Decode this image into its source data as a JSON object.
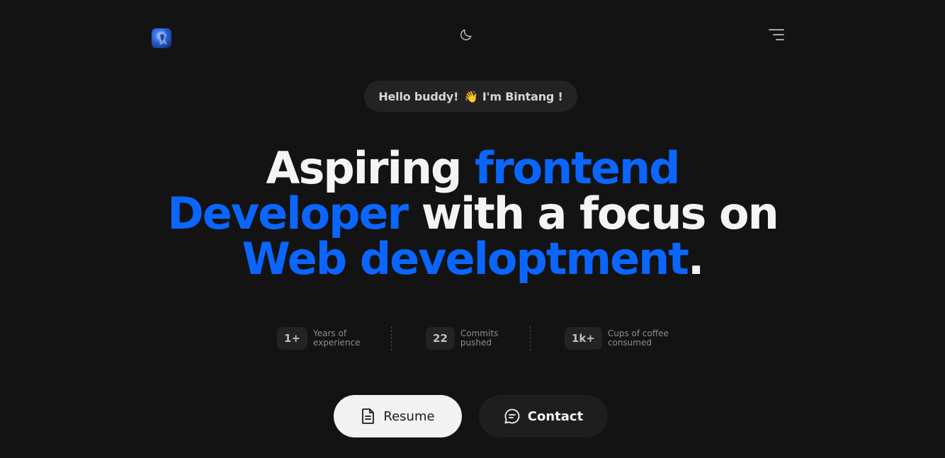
{
  "header": {
    "logo_icon": "avatar-logo",
    "theme_icon": "moon-icon",
    "menu_icon": "menu-icon"
  },
  "greeting": {
    "text_before": "Hello buddy!",
    "emoji": "👋",
    "text_after": "I'm Bintang !"
  },
  "headline": {
    "part1": "Aspiring ",
    "accent1": "frontend",
    "accent2": "Developer",
    "part2": " with a focus on",
    "accent3": "Web developtment",
    "period": "."
  },
  "stats": [
    {
      "value": "1+",
      "label_line1": "Years of",
      "label_line2": "experience"
    },
    {
      "value": "22",
      "label_line1": "Commits",
      "label_line2": "pushed"
    },
    {
      "value": "1k+",
      "label_line1": "Cups of coffee",
      "label_line2": "consumed"
    }
  ],
  "buttons": {
    "resume_label": "Resume",
    "contact_label": "Contact"
  },
  "colors": {
    "background": "#131313",
    "accent": "#0a66ff",
    "pill": "#232323"
  }
}
